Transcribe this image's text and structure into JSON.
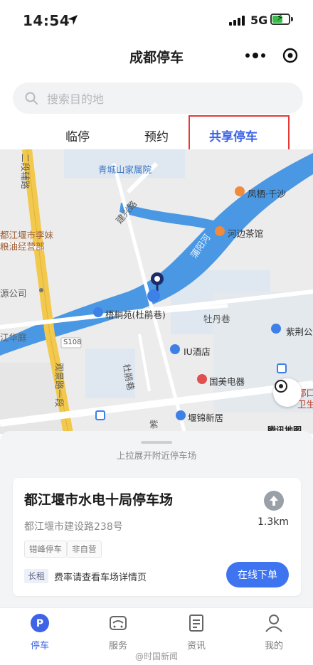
{
  "status_bar": {
    "time": "14:54",
    "network": "5G"
  },
  "nav": {
    "title": "成都停车"
  },
  "search": {
    "placeholder": "搜索目的地"
  },
  "tabs": [
    {
      "label": "临停"
    },
    {
      "label": "预约"
    },
    {
      "label": "共享停车",
      "active": true
    }
  ],
  "map": {
    "labels": {
      "qingcheng": "青城山家属院",
      "fengqi": "凤栖·千沙",
      "hebian": "河边茶馆",
      "puyang": "蒲阳河",
      "jianxing": "建兴路",
      "libai": "都江堰市李妹",
      "libai2": "粮油经营部",
      "yuanco": "源公司",
      "wutong": "梧桐苑(杜鹃巷)",
      "mudan": "牡丹巷",
      "zijing": "紫荆公",
      "jianghua": "江华庭",
      "s108": "S108",
      "guanjing": "观景路一段",
      "dujuan": "杜鹃巷",
      "iu": "IU酒店",
      "guomei": "国美电器",
      "zijin": "紫",
      "yanjin": "堰锦新居",
      "erduan": "二段辅路",
      "brand": "腾讯地图",
      "right_partial": "都口",
      "right_partial2": "卫生"
    }
  },
  "sheet": {
    "pull_hint": "上拉展开附近停车场",
    "lot": {
      "name": "都江堰市水电十局停车场",
      "address": "都江堰市建设路238号",
      "tags": [
        "错峰停车",
        "非自营"
      ],
      "distance": "1.3km",
      "rent_badge": "长租",
      "fee_note": "费率请查看车场详情页",
      "book_label": "在线下单"
    }
  },
  "tabbar": [
    {
      "label": "停车",
      "active": true
    },
    {
      "label": "服务"
    },
    {
      "label": "资讯"
    },
    {
      "label": "我的"
    }
  ],
  "watermark": "@时国新闻",
  "colors": {
    "accent": "#3d63e6",
    "button": "#3f74f0",
    "highlight": "#e53935",
    "water": "#4a98e3"
  }
}
